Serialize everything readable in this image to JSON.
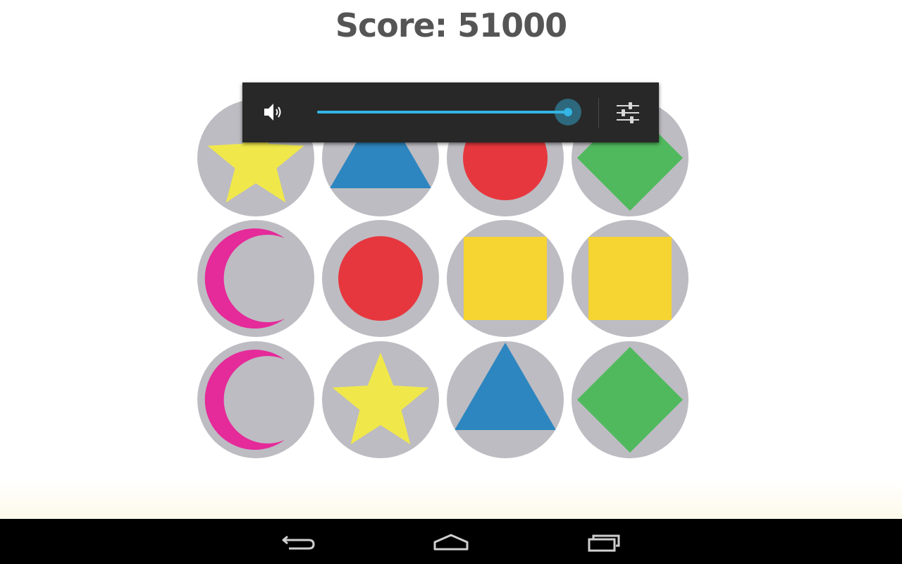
{
  "game": {
    "score_text": "Score: 51000"
  },
  "board": {
    "tile_color": "#bdbcc2",
    "rows": [
      [
        {
          "shape": "star",
          "color": "#f0e84a"
        },
        {
          "shape": "triangle",
          "color": "#2d86c0"
        },
        {
          "shape": "circle",
          "color": "#e7373e"
        },
        {
          "shape": "diamond",
          "color": "#50b95d"
        }
      ],
      [
        {
          "shape": "moon",
          "color": "#e52a9a"
        },
        {
          "shape": "circle",
          "color": "#e7373e"
        },
        {
          "shape": "square",
          "color": "#f6d431"
        },
        {
          "shape": "square",
          "color": "#f6d431"
        }
      ],
      [
        {
          "shape": "moon",
          "color": "#e52a9a"
        },
        {
          "shape": "star",
          "color": "#f0e84a"
        },
        {
          "shape": "triangle",
          "color": "#2d86c0"
        },
        {
          "shape": "diamond",
          "color": "#50b95d"
        }
      ]
    ]
  },
  "volume_panel": {
    "icon": "speaker-icon",
    "settings_icon": "sliders-icon",
    "level": 1.0,
    "accent_color": "#33b5e5"
  },
  "navbar": {
    "buttons": [
      {
        "name": "back",
        "icon": "back-arrow-icon"
      },
      {
        "name": "home",
        "icon": "home-icon"
      },
      {
        "name": "recents",
        "icon": "recent-apps-icon"
      }
    ]
  }
}
